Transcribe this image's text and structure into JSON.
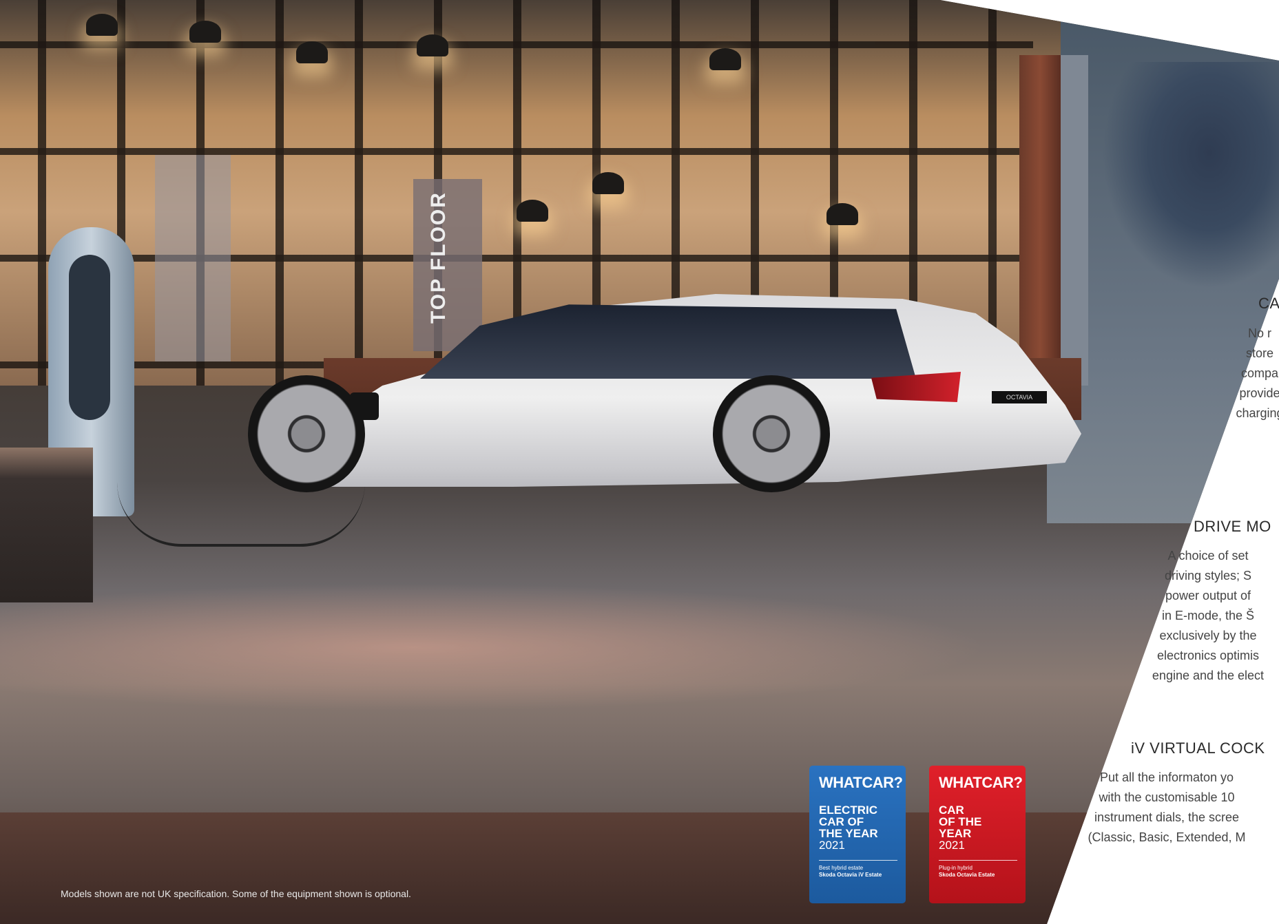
{
  "photo": {
    "top_floor_sign": "TOP FLOOR",
    "car_badge": "OCTAVIA"
  },
  "badges": [
    {
      "brand": "WHATCAR?",
      "award": "ELECTRIC\nCAR OF\nTHE YEAR",
      "year": "2021",
      "category": "Best hybrid estate",
      "model": "Skoda Octavia iV Estate",
      "color": "#1f63ad"
    },
    {
      "brand": "WHATCAR?",
      "award": "CAR\nOF THE\nYEAR",
      "year": "2021",
      "category": "Plug-in hybrid",
      "model": "Skoda Octavia Estate",
      "color": "#d11a23"
    }
  ],
  "disclaimer": "Models shown are not UK specification. Some of the equipment shown is optional.",
  "sections": [
    {
      "title": "CA",
      "lines": [
        "No r",
        "store",
        "compa",
        "provide",
        "charging"
      ]
    },
    {
      "title": "DRIVE MO",
      "lines": [
        "A choice of set",
        "driving styles; S",
        "power output of",
        "in E-mode, the Š",
        "exclusively by the",
        "electronics optimis",
        "engine and the elect"
      ]
    },
    {
      "title": "iV VIRTUAL COCK",
      "lines": [
        "Put all the informaton yo",
        "with the customisable 10",
        "instrument dials, the scree",
        "(Classic, Basic, Extended, M"
      ]
    }
  ]
}
